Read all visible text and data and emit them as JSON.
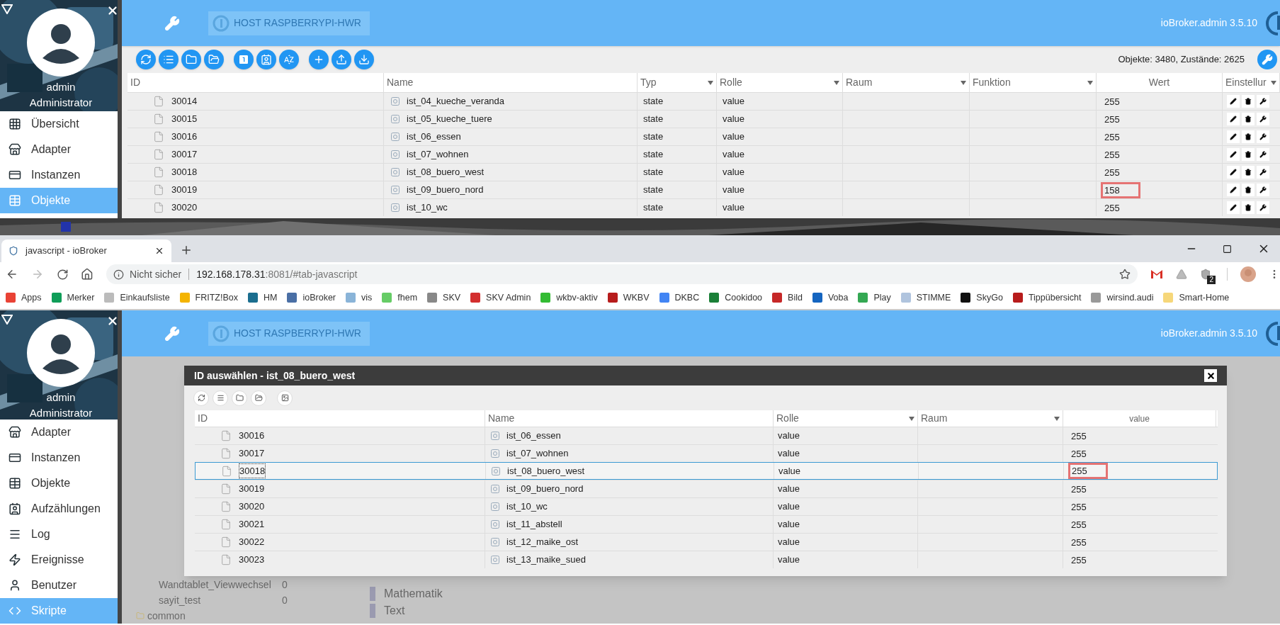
{
  "top_window": {
    "sidebar": {
      "user": "admin",
      "role": "Administrator",
      "items": [
        {
          "label": "Übersicht",
          "selected": false
        },
        {
          "label": "Adapter",
          "selected": false
        },
        {
          "label": "Instanzen",
          "selected": false
        },
        {
          "label": "Objekte",
          "selected": true
        }
      ]
    },
    "header": {
      "host": "HOST RASPBERRYPI-HWR",
      "version": "ioBroker.admin 3.5.10"
    },
    "counts": "Objekte: 3480, Zustände: 2625",
    "table": {
      "columns": [
        {
          "label": "ID",
          "filter": false
        },
        {
          "label": "Name",
          "filter": false
        },
        {
          "label": "Typ",
          "filter": true
        },
        {
          "label": "Rolle",
          "filter": true
        },
        {
          "label": "Raum",
          "filter": true
        },
        {
          "label": "Funktion",
          "filter": true
        },
        {
          "label": "Wert",
          "filter": false
        },
        {
          "label": "Einstellur",
          "filter": true
        }
      ],
      "rows": [
        {
          "id": "30014",
          "name": "ist_04_kueche_veranda",
          "type": "state",
          "role": "value",
          "value": "255",
          "highlighted": false
        },
        {
          "id": "30015",
          "name": "ist_05_kueche_tuere",
          "type": "state",
          "role": "value",
          "value": "255",
          "highlighted": false
        },
        {
          "id": "30016",
          "name": "ist_06_essen",
          "type": "state",
          "role": "value",
          "value": "255",
          "highlighted": false
        },
        {
          "id": "30017",
          "name": "ist_07_wohnen",
          "type": "state",
          "role": "value",
          "value": "255",
          "highlighted": false
        },
        {
          "id": "30018",
          "name": "ist_08_buero_west",
          "type": "state",
          "role": "value",
          "value": "255",
          "highlighted": false
        },
        {
          "id": "30019",
          "name": "ist_09_buero_nord",
          "type": "state",
          "role": "value",
          "value": "158",
          "highlighted": true
        },
        {
          "id": "30020",
          "name": "ist_10_wc",
          "type": "state",
          "role": "value",
          "value": "255",
          "highlighted": false
        }
      ]
    }
  },
  "browser": {
    "tab": {
      "title": "javascript - ioBroker"
    },
    "security": "Nicht sicher",
    "url_host": "192.168.178.31",
    "url_rest": ":8081/#tab-javascript",
    "extension_badge": "2",
    "bookmarks": [
      "Apps",
      "Merker",
      "Einkaufsliste",
      "FRITZ!Box",
      "HM",
      "ioBroker",
      "vis",
      "fhem",
      "SKV",
      "SKV Admin",
      "wkbv-aktiv",
      "WKBV",
      "DKBC",
      "Cookidoo",
      "Bild",
      "Voba",
      "Play",
      "STIMME",
      "SkyGo",
      "Tippübersicht",
      "wirsind.audi",
      "Smart-Home"
    ]
  },
  "bottom_window": {
    "sidebar": {
      "user": "admin",
      "role": "Administrator",
      "items": [
        {
          "label": "Adapter",
          "selected": false
        },
        {
          "label": "Instanzen",
          "selected": false
        },
        {
          "label": "Objekte",
          "selected": false
        },
        {
          "label": "Aufzählungen",
          "selected": false
        },
        {
          "label": "Log",
          "selected": false
        },
        {
          "label": "Ereignisse",
          "selected": false
        },
        {
          "label": "Benutzer",
          "selected": false
        },
        {
          "label": "Skripte",
          "selected": true
        }
      ]
    },
    "header": {
      "host": "HOST RASPBERRYPI-HWR",
      "version": "ioBroker.admin 3.5.10"
    },
    "background": {
      "scripts": [
        {
          "name": "Wandtablet_Viewwechsel",
          "count": "0"
        },
        {
          "name": "sayit_test",
          "count": "0"
        }
      ],
      "folder": "common",
      "categories": [
        "Mathematik",
        "Text"
      ]
    },
    "dialog": {
      "title": "ID auswählen - ist_08_buero_west",
      "columns": [
        {
          "label": "ID",
          "filter": false
        },
        {
          "label": "Name",
          "filter": false
        },
        {
          "label": "Rolle",
          "filter": true
        },
        {
          "label": "Raum",
          "filter": true
        },
        {
          "label": "value",
          "filter": false
        }
      ],
      "rows": [
        {
          "id": "30016",
          "name": "ist_06_essen",
          "role": "value",
          "value": "255",
          "selected": false,
          "highlighted": false
        },
        {
          "id": "30017",
          "name": "ist_07_wohnen",
          "role": "value",
          "value": "255",
          "selected": false,
          "highlighted": false
        },
        {
          "id": "30018",
          "name": "ist_08_buero_west",
          "role": "value",
          "value": "255",
          "selected": true,
          "highlighted": true
        },
        {
          "id": "30019",
          "name": "ist_09_buero_nord",
          "role": "value",
          "value": "255",
          "selected": false,
          "highlighted": false
        },
        {
          "id": "30020",
          "name": "ist_10_wc",
          "role": "value",
          "value": "255",
          "selected": false,
          "highlighted": false
        },
        {
          "id": "30021",
          "name": "ist_11_abstell",
          "role": "value",
          "value": "255",
          "selected": false,
          "highlighted": false
        },
        {
          "id": "30022",
          "name": "ist_12_maike_ost",
          "role": "value",
          "value": "255",
          "selected": false,
          "highlighted": false
        },
        {
          "id": "30023",
          "name": "ist_13_maike_sued",
          "role": "value",
          "value": "255",
          "selected": false,
          "highlighted": false
        }
      ]
    }
  }
}
